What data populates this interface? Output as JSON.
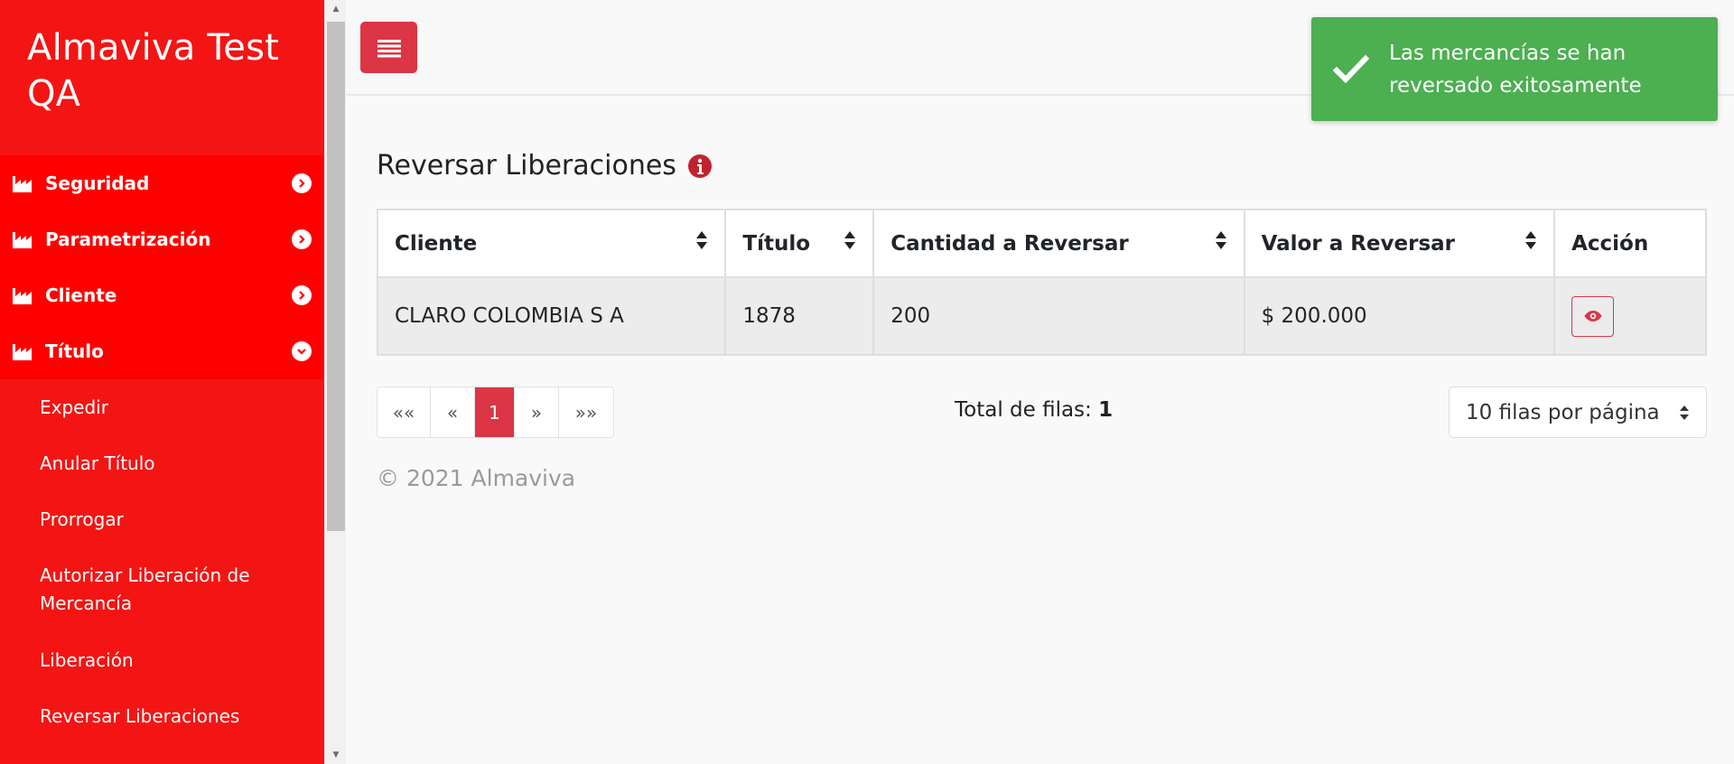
{
  "sidebar": {
    "brand": "Almaviva Test QA",
    "menu": [
      {
        "label": "Seguridad"
      },
      {
        "label": "Parametrización"
      },
      {
        "label": "Cliente"
      },
      {
        "label": "Título"
      }
    ],
    "submenu": [
      {
        "label": "Expedir"
      },
      {
        "label": "Anular Título"
      },
      {
        "label": "Prorrogar"
      },
      {
        "label": "Autorizar Liberación de Mercancía"
      },
      {
        "label": "Liberación"
      },
      {
        "label": "Reversar Liberaciones"
      }
    ]
  },
  "toast": {
    "message": "Las mercancías se han reversado exitosamente"
  },
  "main": {
    "title": "Reversar Liberaciones",
    "table": {
      "columns": [
        "Cliente",
        "Título",
        "Cantidad a Reversar",
        "Valor a Reversar",
        "Acción"
      ],
      "rows": [
        {
          "cliente": "CLARO COLOMBIA S A",
          "titulo": "1878",
          "cantidad": "200",
          "valor": "$ 200.000"
        }
      ]
    },
    "pagination": {
      "first": "««",
      "prev": "«",
      "current": "1",
      "next": "»",
      "last": "»»"
    },
    "total_label": "Total de filas:",
    "total_value": "1",
    "rows_per_page": "10 filas por página"
  },
  "footer": {
    "text": "© 2021 Almaviva"
  },
  "colors": {
    "sidebar": "#f51414",
    "menu": "#ff0000",
    "accent": "#dc3545",
    "toast": "#4caf50"
  },
  "icons": {
    "menu": "factory-icon",
    "chevron": "chevron-circle-icon",
    "hamburger": "hamburger-icon",
    "info": "info-icon",
    "view": "eye-icon",
    "toast": "check-icon"
  }
}
